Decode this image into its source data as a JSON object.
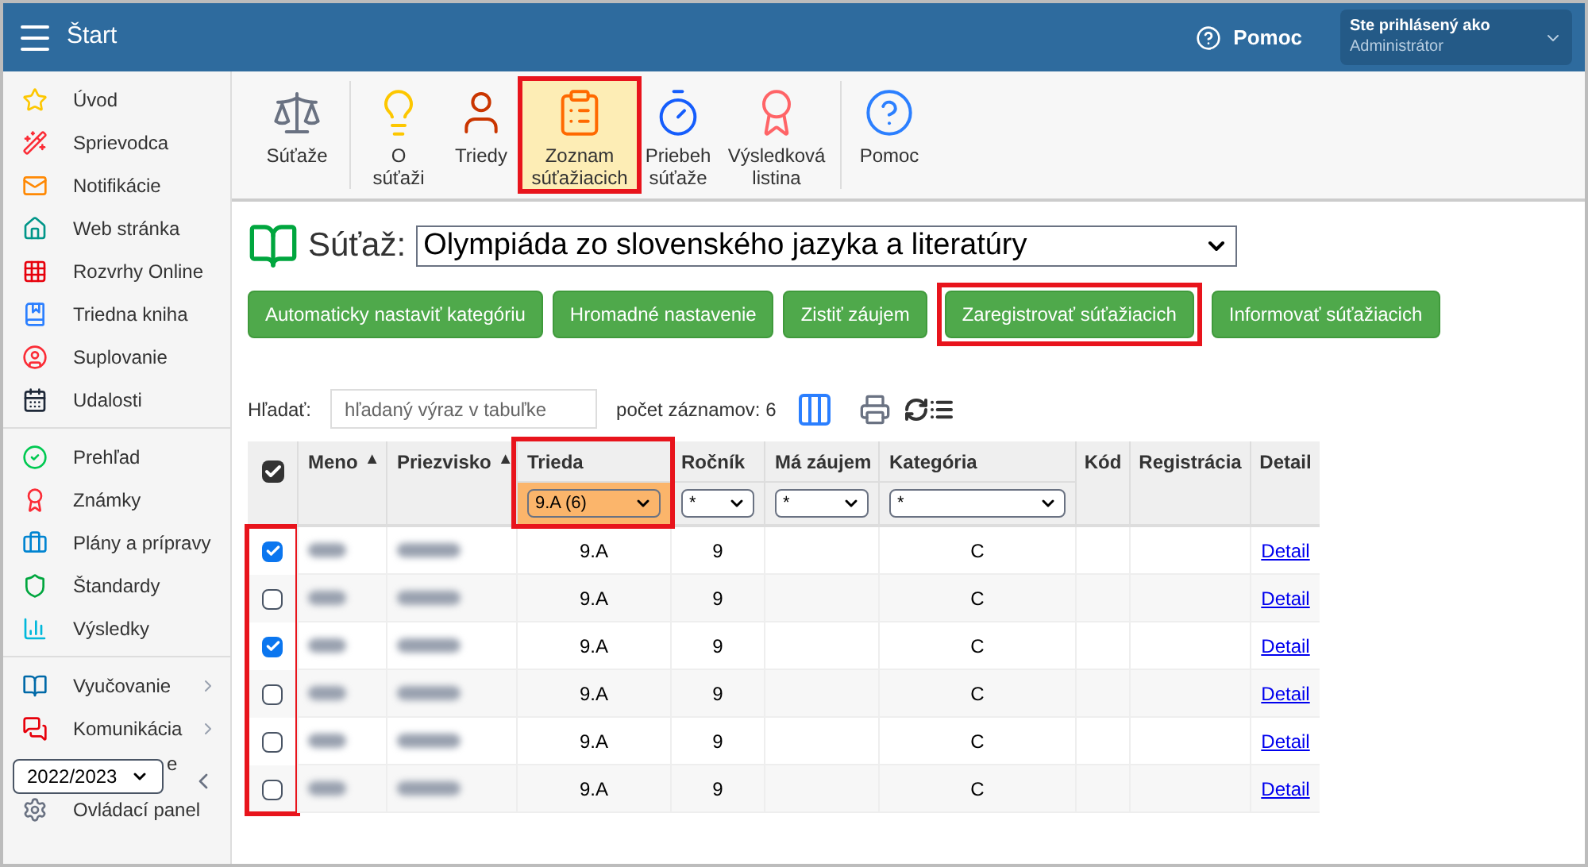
{
  "header": {
    "title": "Štart",
    "help": "Pomoc",
    "user_label": "Ste prihlásený ako",
    "user_role": "Administrátor"
  },
  "sidebar": {
    "groups": [
      [
        {
          "label": "Úvod"
        },
        {
          "label": "Sprievodca"
        },
        {
          "label": "Notifikácie"
        },
        {
          "label": "Web stránka"
        },
        {
          "label": "Rozvrhy Online"
        },
        {
          "label": "Triedna kniha"
        },
        {
          "label": "Suplovanie"
        },
        {
          "label": "Udalosti"
        }
      ],
      [
        {
          "label": "Prehľad"
        },
        {
          "label": "Známky"
        },
        {
          "label": "Plány a prípravy"
        },
        {
          "label": "Štandardy"
        },
        {
          "label": "Výsledky"
        }
      ],
      [
        {
          "label": "Vyučovanie",
          "expandable": true
        },
        {
          "label": "Komunikácia",
          "expandable": true
        }
      ]
    ],
    "covered_item": {
      "label": "e"
    },
    "year": "2022/2023",
    "cut_item": {
      "label": "Ovládací panel"
    }
  },
  "toolbar": [
    {
      "label": "Súťaže",
      "selected": false,
      "highlighted": false
    },
    {
      "label": "O súťaži",
      "selected": false,
      "highlighted": false
    },
    {
      "label": "Triedy",
      "selected": false,
      "highlighted": false
    },
    {
      "label": "Zoznam súťažiacich",
      "selected": true,
      "highlighted": true
    },
    {
      "label": "Priebeh súťaže",
      "selected": false,
      "highlighted": false
    },
    {
      "label": "Výsledková listina",
      "selected": false,
      "highlighted": false
    },
    {
      "label": "Pomoc",
      "selected": false,
      "highlighted": false
    }
  ],
  "competition": {
    "label": "Súťaž:",
    "value": "Olympiáda zo slovenského jazyka a literatúry"
  },
  "actions": [
    {
      "label": "Automaticky nastaviť kategóriu",
      "highlighted": false
    },
    {
      "label": "Hromadné nastavenie",
      "highlighted": false
    },
    {
      "label": "Zistiť záujem",
      "highlighted": false
    },
    {
      "label": "Zaregistrovať súťažiacich",
      "highlighted": true
    },
    {
      "label": "Informovať súťažiacich",
      "highlighted": false
    }
  ],
  "search": {
    "label": "Hľadať:",
    "placeholder": "hľadaný výraz v tabuľke",
    "count": "počet záznamov: 6"
  },
  "table": {
    "all_checked": true,
    "checkbox_column_highlighted": true,
    "columns": [
      {
        "label": "Meno",
        "sort": "▲"
      },
      {
        "label": "Priezvisko",
        "sort": "▲"
      },
      {
        "label": "Trieda",
        "filter": "9.A (6)",
        "highlighted": true
      },
      {
        "label": "Ročník",
        "filter": "*",
        "highlighted": false
      },
      {
        "label": "Má záujem",
        "filter": "*",
        "highlighted": false
      },
      {
        "label": "Kategória",
        "filter": "*",
        "highlighted": false
      },
      {
        "label": "Kód"
      },
      {
        "label": "Registrácia"
      },
      {
        "label": "Detail"
      }
    ],
    "rows": [
      {
        "checked": true,
        "trieda": "9.A",
        "rocnik": "9",
        "kategoria": "C",
        "detail": "Detail"
      },
      {
        "checked": false,
        "trieda": "9.A",
        "rocnik": "9",
        "kategoria": "C",
        "detail": "Detail"
      },
      {
        "checked": true,
        "trieda": "9.A",
        "rocnik": "9",
        "kategoria": "C",
        "detail": "Detail"
      },
      {
        "checked": false,
        "trieda": "9.A",
        "rocnik": "9",
        "kategoria": "C",
        "detail": "Detail"
      },
      {
        "checked": false,
        "trieda": "9.A",
        "rocnik": "9",
        "kategoria": "C",
        "detail": "Detail"
      },
      {
        "checked": false,
        "trieda": "9.A",
        "rocnik": "9",
        "kategoria": "C",
        "detail": "Detail"
      }
    ]
  }
}
